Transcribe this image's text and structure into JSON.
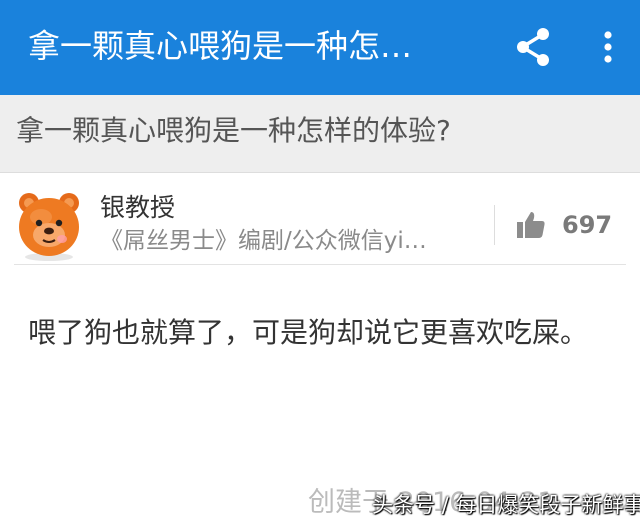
{
  "appbar": {
    "title": "拿一颗真心喂狗是一种怎…",
    "share_icon": "share-icon",
    "more_icon": "more-vertical-icon",
    "color": "#1a82dc"
  },
  "question": {
    "title": "拿一颗真心喂狗是一种怎样的体验?"
  },
  "author": {
    "name": "银教授",
    "bio": "《屌丝男士》编剧/公众微信yi…",
    "avatar_icon": "bear-avatar-icon"
  },
  "vote": {
    "icon": "thumbs-up-icon",
    "count": "697"
  },
  "answer": {
    "text": "喂了狗也就算了，可是狗却说它更喜欢吃屎。"
  },
  "footer": {
    "created_text": "创建于 2016-04-21"
  },
  "watermark": {
    "text": "头条号 / 每日爆笑段子新鲜事"
  }
}
